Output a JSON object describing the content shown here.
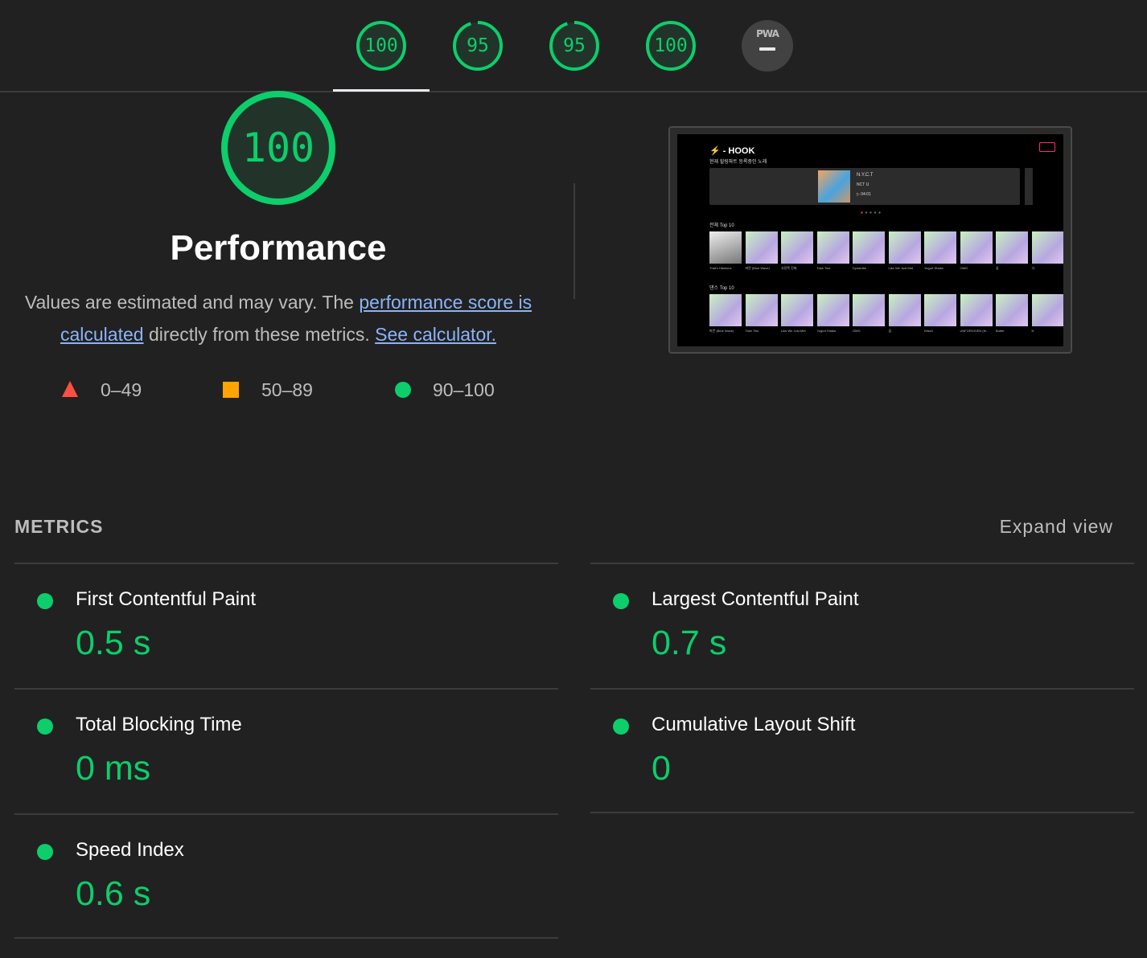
{
  "top_gauges": [
    {
      "score": "100",
      "value": 1.0
    },
    {
      "score": "95",
      "value": 0.95
    },
    {
      "score": "95",
      "value": 0.95
    },
    {
      "score": "100",
      "value": 1.0
    }
  ],
  "pwa": {
    "label": "PWA"
  },
  "category": {
    "score": "100",
    "title": "Performance",
    "desc_prefix": "Values are estimated and may vary. The ",
    "desc_link1": "performance score is calculated",
    "desc_mid": " directly from these metrics. ",
    "desc_link2": "See calculator."
  },
  "legend": [
    {
      "range": "0–49",
      "shape": "triangle",
      "color": "#ff4e42"
    },
    {
      "range": "50–89",
      "shape": "square",
      "color": "#ffa400"
    },
    {
      "range": "90–100",
      "shape": "circle",
      "color": "#0cce6b"
    }
  ],
  "screenshot": {
    "logo": "- HOOK",
    "now_playing_label": "현재 힐링파트 등록중인 노래",
    "song_title": "N.Y.C.T",
    "song_artist": "NCT U",
    "song_time": "▷ 04:01",
    "section1": "전체 Top 10",
    "section2": "댄스 Top 10",
    "row1_captions": [
      "That's Hilarious",
      "파란 (Blue Wave)",
      "사랑쪽 진짜",
      "Take Two",
      "Dynamite",
      "Like We Just Met",
      "Yogurt Shake",
      "OMG",
      "꿈",
      "사"
    ],
    "row2_captions": [
      "파란 (Blue Wave)",
      "Take Two",
      "Like We Just Met",
      "Yogurt Shake",
      "OMG",
      "꿈",
      "Kitsch",
      "UNFORGIVEN (fe..",
      "Butter",
      "N"
    ]
  },
  "metrics": {
    "heading": "METRICS",
    "expand": "Expand view",
    "items": [
      {
        "title": "First Contentful Paint",
        "value": "0.5 s"
      },
      {
        "title": "Largest Contentful Paint",
        "value": "0.7 s"
      },
      {
        "title": "Total Blocking Time",
        "value": "0 ms"
      },
      {
        "title": "Cumulative Layout Shift",
        "value": "0"
      },
      {
        "title": "Speed Index",
        "value": "0.6 s"
      }
    ]
  },
  "colors": {
    "pass": "#0cce6b",
    "link": "#8ab4f8",
    "background": "#212121"
  }
}
